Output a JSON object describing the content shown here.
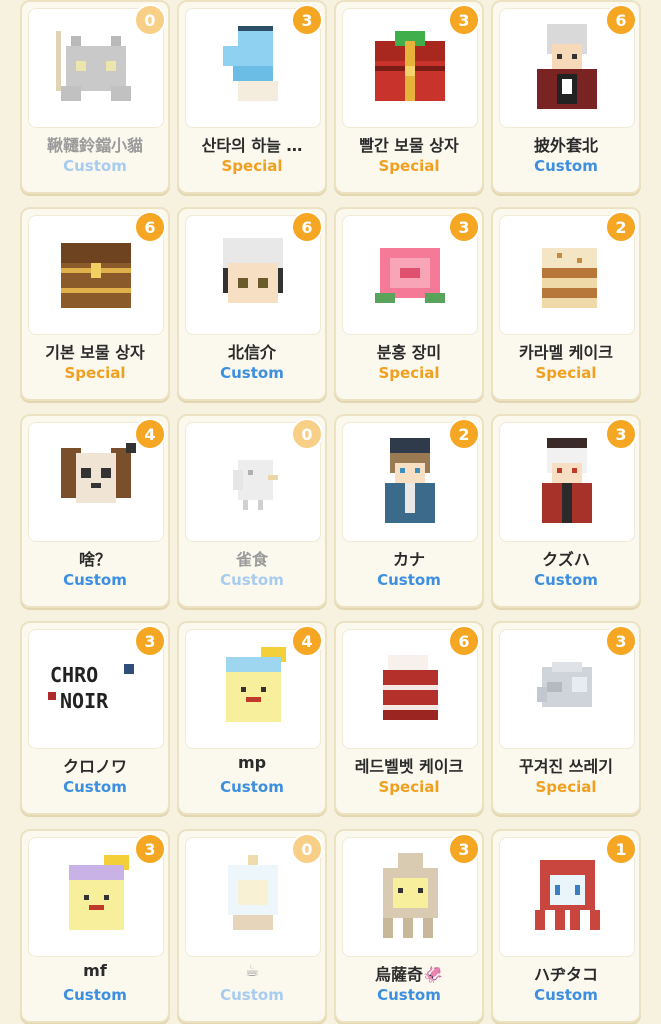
{
  "items": [
    {
      "name": "鞦韆鈴鐺小貓",
      "type": "Custom",
      "count": "0",
      "icon": "gray-cat-icon",
      "dim": true
    },
    {
      "name": "산타의 하늘 …",
      "type": "Special",
      "count": "3",
      "icon": "blue-mitten-icon",
      "dim": false
    },
    {
      "name": "빨간 보물 상자",
      "type": "Special",
      "count": "3",
      "icon": "red-treasure-chest-icon",
      "dim": false
    },
    {
      "name": "披外套北",
      "type": "Custom",
      "count": "6",
      "icon": "white-hair-boy-icon",
      "dim": false
    },
    {
      "name": "기본 보물 상자",
      "type": "Special",
      "count": "6",
      "icon": "wooden-treasure-chest-icon",
      "dim": false
    },
    {
      "name": "北信介",
      "type": "Custom",
      "count": "6",
      "icon": "white-hair-face-icon",
      "dim": false
    },
    {
      "name": "분홍 장미",
      "type": "Special",
      "count": "3",
      "icon": "pink-rose-icon",
      "dim": false
    },
    {
      "name": "카라멜 케이크",
      "type": "Special",
      "count": "2",
      "icon": "caramel-cake-icon",
      "dim": false
    },
    {
      "name": "啥？",
      "type": "Custom",
      "count": "4",
      "icon": "brown-dog-icon",
      "dim": false
    },
    {
      "name": "雀食",
      "type": "Custom",
      "count": "0",
      "icon": "white-bird-icon",
      "dim": true
    },
    {
      "name": "カナ",
      "type": "Custom",
      "count": "2",
      "icon": "boy-beanie-icon",
      "dim": false
    },
    {
      "name": "クズハ",
      "type": "Custom",
      "count": "3",
      "icon": "white-hair-red-coat-icon",
      "dim": false
    },
    {
      "name": "クロノワ",
      "type": "Custom",
      "count": "3",
      "icon": "chro-noir-text-icon",
      "dim": false
    },
    {
      "name": "mp",
      "type": "Custom",
      "count": "4",
      "icon": "crowned-blob-blue-icon",
      "dim": false
    },
    {
      "name": "레드벨벳 케이크",
      "type": "Special",
      "count": "6",
      "icon": "red-velvet-cake-icon",
      "dim": false
    },
    {
      "name": "꾸겨진 쓰레기",
      "type": "Special",
      "count": "3",
      "icon": "crumpled-paper-icon",
      "dim": false
    },
    {
      "name": "mf",
      "type": "Custom",
      "count": "3",
      "icon": "crowned-blob-purple-icon",
      "dim": false
    },
    {
      "name": "☕",
      "type": "Custom",
      "count": "0",
      "icon": "snow-globe-icon",
      "dim": true
    },
    {
      "name": "烏薩奇🦑",
      "type": "Custom",
      "count": "3",
      "icon": "squid-hood-icon",
      "dim": false
    },
    {
      "name": "ハヂタコ",
      "type": "Custom",
      "count": "1",
      "icon": "octopus-hood-icon",
      "dim": false
    }
  ],
  "colors": {
    "custom": "#3d8fe0",
    "special": "#f0a020",
    "badge": "#f5a623"
  }
}
